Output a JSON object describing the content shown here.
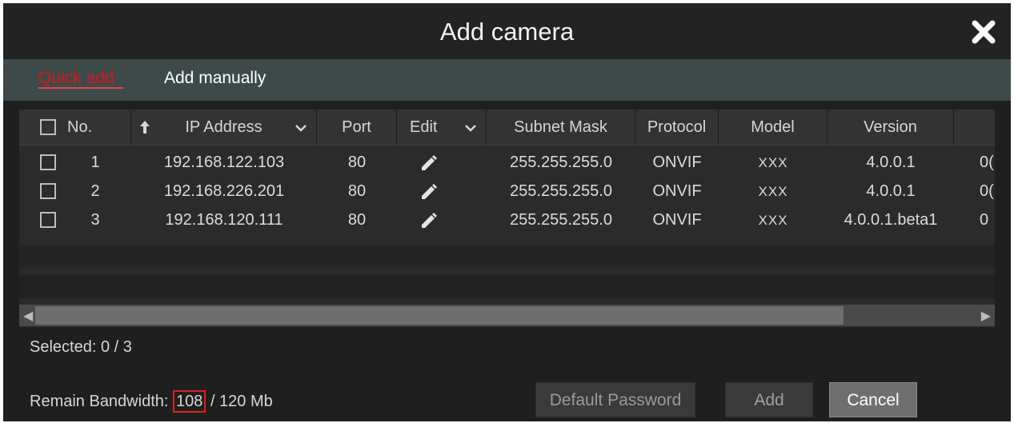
{
  "dialog": {
    "title": "Add camera",
    "close_icon": "close-icon"
  },
  "tabs": [
    {
      "label": "Quick add",
      "active": true
    },
    {
      "label": "Add manually",
      "active": false
    }
  ],
  "table": {
    "headers": {
      "no": "No.",
      "ip": "IP Address",
      "port": "Port",
      "edit": "Edit",
      "subnet": "Subnet Mask",
      "protocol": "Protocol",
      "model": "Model",
      "version": "Version"
    },
    "rows": [
      {
        "no": "1",
        "ip": "192.168.122.103",
        "port": "80",
        "subnet": "255.255.255.0",
        "protocol": "ONVIF",
        "model": "XXX",
        "version": "4.0.0.1",
        "extra": "0("
      },
      {
        "no": "2",
        "ip": "192.168.226.201",
        "port": "80",
        "subnet": "255.255.255.0",
        "protocol": "ONVIF",
        "model": "XXX",
        "version": "4.0.0.1",
        "extra": "0("
      },
      {
        "no": "3",
        "ip": "192.168.120.111",
        "port": "80",
        "subnet": "255.255.255.0",
        "protocol": "ONVIF",
        "model": "XXX",
        "version": "4.0.0.1.beta1",
        "extra": "0"
      }
    ]
  },
  "status": {
    "selected_label": "Selected: 0 / 3",
    "bandwidth_label": "Remain Bandwidth:",
    "bandwidth_remaining": "108",
    "bandwidth_total": "/ 120 Mb"
  },
  "buttons": {
    "default_password": "Default Password",
    "add": "Add",
    "cancel": "Cancel"
  },
  "colors": {
    "accent_red": "#d8151b",
    "tabbar": "#3e4a49",
    "background": "#1f1f1f"
  }
}
